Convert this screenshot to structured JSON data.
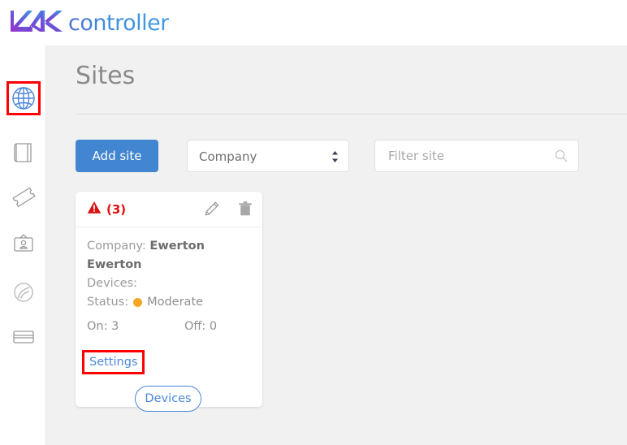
{
  "header": {
    "logo_mark": "mk-logo-icon",
    "logo_text": "controller"
  },
  "sidebar": {
    "items": [
      {
        "icon": "globe-icon",
        "name": "sites",
        "active": true
      },
      {
        "icon": "book-icon",
        "name": "catalog",
        "active": false
      },
      {
        "icon": "ticket-icon",
        "name": "tickets",
        "active": false
      },
      {
        "icon": "id-badge-icon",
        "name": "contacts",
        "active": false
      },
      {
        "icon": "moon-icon",
        "name": "theme",
        "active": false
      },
      {
        "icon": "credit-card-icon",
        "name": "billing",
        "active": false
      }
    ]
  },
  "main": {
    "page_title": "Sites",
    "toolbar": {
      "add_label": "Add site",
      "select_value": "Company",
      "filter_placeholder": "Filter site",
      "filter_value": "",
      "search_icon": "search-icon",
      "stepper_icon": "up-down-arrows-icon"
    },
    "card": {
      "alert_icon": "warning-triangle-icon",
      "alert_count": "(3)",
      "edit_icon": "pencil-icon",
      "delete_icon": "trash-icon",
      "company_label": "Company:",
      "company_value": "Ewerton Ewerton",
      "devices_label": "Devices:",
      "devices_value": "",
      "status_label": "Status:",
      "status_value": "Moderate",
      "status_color": "#f5a623",
      "on_label": "On: 3",
      "off_label": "Off: 0",
      "settings_link": "Settings",
      "devices_button": "Devices"
    }
  },
  "colors": {
    "primary": "#4285d0",
    "link": "#4a86d8",
    "alert": "#e01010",
    "highlight": "#ff0000",
    "status_moderate": "#f5a623",
    "page_bg": "#f1f1f1"
  }
}
